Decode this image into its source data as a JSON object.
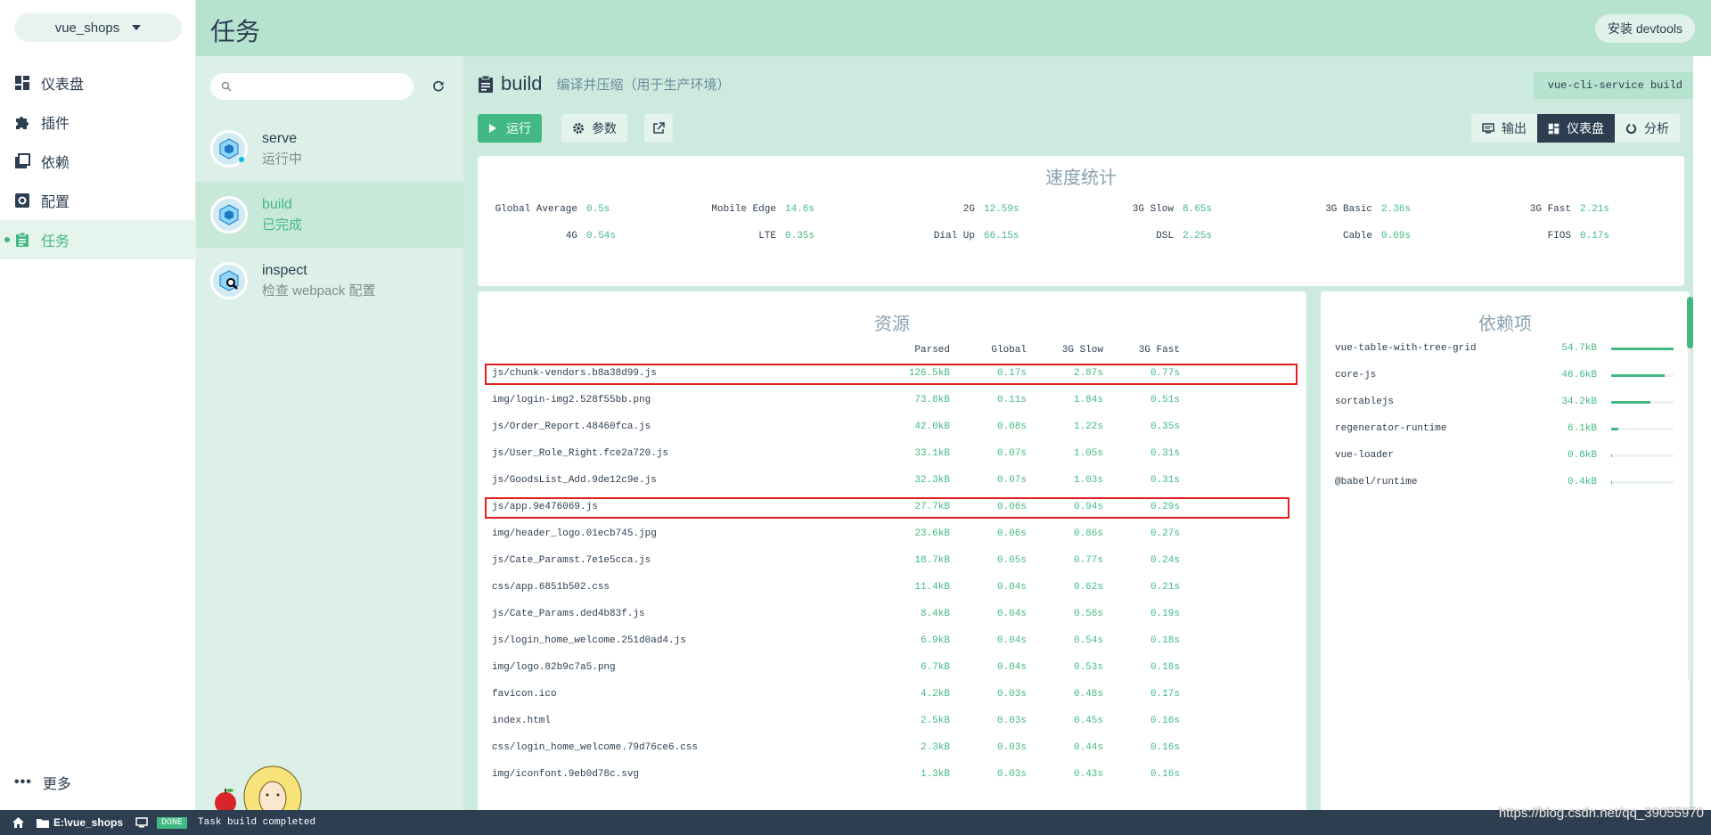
{
  "app": {
    "project_name": "vue_shops",
    "page_title": "任务",
    "devtools_button": "安装 devtools"
  },
  "nav": {
    "items": [
      {
        "label": "仪表盘",
        "icon": "dashboard-icon"
      },
      {
        "label": "插件",
        "icon": "puzzle-icon"
      },
      {
        "label": "依赖",
        "icon": "library-icon"
      },
      {
        "label": "配置",
        "icon": "settings-icon"
      },
      {
        "label": "任务",
        "icon": "assignment-icon",
        "active": true
      }
    ],
    "more_label": "更多"
  },
  "tasks": {
    "search_placeholder": "",
    "items": [
      {
        "name": "serve",
        "description": "运行中",
        "status": "running"
      },
      {
        "name": "build",
        "description": "已完成",
        "active": true
      },
      {
        "name": "inspect",
        "description": "检查 webpack 配置"
      }
    ]
  },
  "task": {
    "title": "build",
    "subtitle": "编译并压缩（用于生产环境）",
    "command": "vue-cli-service build",
    "run_label": "运行",
    "params_label": "参数",
    "tabs": [
      {
        "label": "输出"
      },
      {
        "label": "仪表盘",
        "active": true
      },
      {
        "label": "分析"
      }
    ]
  },
  "speed": {
    "title": "速度统计",
    "stats": [
      {
        "label": "Global Average",
        "value": "0.5s"
      },
      {
        "label": "Mobile Edge",
        "value": "14.6s"
      },
      {
        "label": "2G",
        "value": "12.59s"
      },
      {
        "label": "3G Slow",
        "value": "8.65s"
      },
      {
        "label": "3G Basic",
        "value": "2.36s"
      },
      {
        "label": "3G Fast",
        "value": "2.21s"
      },
      {
        "label": "4G",
        "value": "0.54s"
      },
      {
        "label": "LTE",
        "value": "0.35s"
      },
      {
        "label": "Dial Up",
        "value": "66.15s"
      },
      {
        "label": "DSL",
        "value": "2.25s"
      },
      {
        "label": "Cable",
        "value": "0.69s"
      },
      {
        "label": "FIOS",
        "value": "0.17s"
      }
    ]
  },
  "assets": {
    "title": "资源",
    "columns": [
      "Parsed",
      "Global",
      "3G Slow",
      "3G Fast"
    ],
    "rows": [
      {
        "name": "js/chunk-vendors.b8a38d99.js",
        "parsed": "126.5kB",
        "global": "0.17s",
        "slow": "2.87s",
        "fast": "0.77s",
        "highlight": true
      },
      {
        "name": "img/login-img2.528f55bb.png",
        "parsed": "73.8kB",
        "global": "0.11s",
        "slow": "1.84s",
        "fast": "0.51s"
      },
      {
        "name": "js/Order_Report.48460fca.js",
        "parsed": "42.0kB",
        "global": "0.08s",
        "slow": "1.22s",
        "fast": "0.35s"
      },
      {
        "name": "js/User_Role_Right.fce2a720.js",
        "parsed": "33.1kB",
        "global": "0.07s",
        "slow": "1.05s",
        "fast": "0.31s"
      },
      {
        "name": "js/GoodsList_Add.9de12c9e.js",
        "parsed": "32.3kB",
        "global": "0.07s",
        "slow": "1.03s",
        "fast": "0.31s"
      },
      {
        "name": "js/app.9e476069.js",
        "parsed": "27.7kB",
        "global": "0.06s",
        "slow": "0.94s",
        "fast": "0.29s",
        "highlight": true
      },
      {
        "name": "img/header_logo.01ecb745.jpg",
        "parsed": "23.6kB",
        "global": "0.06s",
        "slow": "0.86s",
        "fast": "0.27s"
      },
      {
        "name": "js/Cate_Paramst.7e1e5cca.js",
        "parsed": "18.7kB",
        "global": "0.05s",
        "slow": "0.77s",
        "fast": "0.24s"
      },
      {
        "name": "css/app.6851b502.css",
        "parsed": "11.4kB",
        "global": "0.04s",
        "slow": "0.62s",
        "fast": "0.21s"
      },
      {
        "name": "js/Cate_Params.ded4b83f.js",
        "parsed": "8.4kB",
        "global": "0.04s",
        "slow": "0.56s",
        "fast": "0.19s"
      },
      {
        "name": "js/login_home_welcome.251d0ad4.js",
        "parsed": "6.9kB",
        "global": "0.04s",
        "slow": "0.54s",
        "fast": "0.18s"
      },
      {
        "name": "img/logo.82b9c7a5.png",
        "parsed": "6.7kB",
        "global": "0.04s",
        "slow": "0.53s",
        "fast": "0.18s"
      },
      {
        "name": "favicon.ico",
        "parsed": "4.2kB",
        "global": "0.03s",
        "slow": "0.48s",
        "fast": "0.17s"
      },
      {
        "name": "index.html",
        "parsed": "2.5kB",
        "global": "0.03s",
        "slow": "0.45s",
        "fast": "0.16s"
      },
      {
        "name": "css/login_home_welcome.79d76ce6.css",
        "parsed": "2.3kB",
        "global": "0.03s",
        "slow": "0.44s",
        "fast": "0.16s"
      },
      {
        "name": "img/iconfont.9eb0d78c.svg",
        "parsed": "1.3kB",
        "global": "0.03s",
        "slow": "0.43s",
        "fast": "0.16s"
      }
    ]
  },
  "deps": {
    "title": "依赖项",
    "items": [
      {
        "name": "vue-table-with-tree-grid",
        "size": "54.7kB",
        "ratio": 1.0
      },
      {
        "name": "core-js",
        "size": "46.6kB",
        "ratio": 0.85
      },
      {
        "name": "sortablejs",
        "size": "34.2kB",
        "ratio": 0.63
      },
      {
        "name": "regenerator-runtime",
        "size": "6.1kB",
        "ratio": 0.11
      },
      {
        "name": "vue-loader",
        "size": "0.8kB",
        "ratio": 0.02
      },
      {
        "name": "@babel/runtime",
        "size": "0.4kB",
        "ratio": 0.01
      }
    ]
  },
  "statusbar": {
    "path": "E:\\vue_shops",
    "badge": "DONE",
    "message": "Task build completed",
    "watermark": "https://blog.csdn.net/qq_39055970"
  },
  "colors": {
    "accent": "#42b983",
    "header_bg": "#b6e2d0",
    "statusbar_bg": "#2c3e50",
    "highlight_box": "#e41d1d"
  }
}
